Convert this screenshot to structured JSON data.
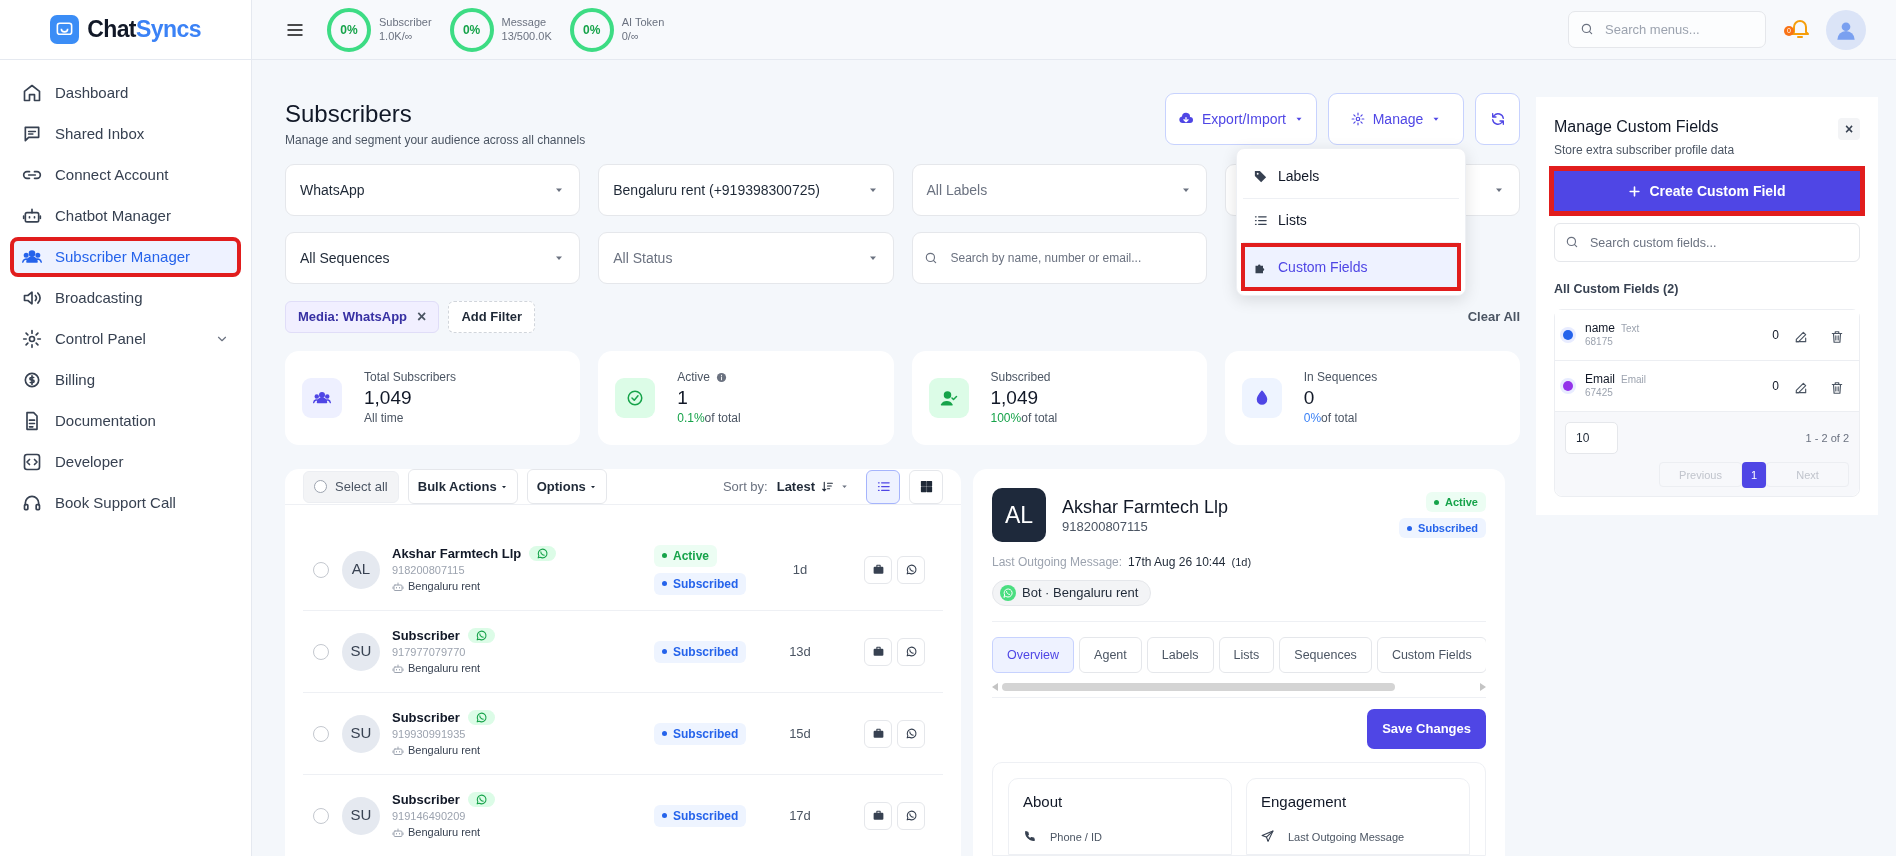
{
  "brand": {
    "name_dark": "Chat",
    "name_accent": "Syncs"
  },
  "usage": [
    {
      "percent": "0%",
      "label": "Subscriber",
      "value": "1.0K/∞"
    },
    {
      "percent": "0%",
      "label": "Message",
      "value": "13/500.0K"
    },
    {
      "percent": "0%",
      "label": "AI Token",
      "value": "0/∞"
    }
  ],
  "search_menus": {
    "placeholder": "Search menus..."
  },
  "notifications": {
    "count": "0"
  },
  "sidebar": {
    "items": [
      {
        "label": "Dashboard",
        "selected": false,
        "has_submenu": false
      },
      {
        "label": "Shared Inbox",
        "selected": false,
        "has_submenu": false
      },
      {
        "label": "Connect Account",
        "selected": false,
        "has_submenu": false
      },
      {
        "label": "Chatbot Manager",
        "selected": false,
        "has_submenu": false
      },
      {
        "label": "Subscriber Manager",
        "selected": true,
        "has_submenu": false,
        "highlighted": true
      },
      {
        "label": "Broadcasting",
        "selected": false,
        "has_submenu": false
      },
      {
        "label": "Control Panel",
        "selected": false,
        "has_submenu": true
      },
      {
        "label": "Billing",
        "selected": false,
        "has_submenu": false
      },
      {
        "label": "Documentation",
        "selected": false,
        "has_submenu": false
      },
      {
        "label": "Developer",
        "selected": false,
        "has_submenu": false
      },
      {
        "label": "Book Support Call",
        "selected": false,
        "has_submenu": false
      }
    ]
  },
  "page": {
    "title": "Subscribers",
    "subtitle": "Manage and segment your audience across all channels"
  },
  "actions": [
    {
      "kind": "export",
      "label": "Export/Import"
    },
    {
      "kind": "manage",
      "label": "Manage"
    },
    {
      "kind": "refresh"
    }
  ],
  "manage_menu": [
    {
      "label": "Labels",
      "selected": false,
      "highlighted": false
    },
    {
      "label": "Lists",
      "selected": false,
      "highlighted": false
    },
    {
      "label": "Custom Fields",
      "selected": true,
      "highlighted": true
    }
  ],
  "filters": [
    {
      "kind": "select",
      "value": "WhatsApp"
    },
    {
      "kind": "select",
      "value": "Bengaluru rent (+919398300725)"
    },
    {
      "kind": "select",
      "placeholder": "All Labels"
    },
    {
      "kind": "select"
    },
    {
      "kind": "select",
      "value": "All Sequences"
    },
    {
      "kind": "select",
      "placeholder": "All Status"
    },
    {
      "kind": "search",
      "placeholder": "Search by name, number or email..."
    }
  ],
  "active_filters": [
    {
      "label": "Media: WhatsApp",
      "remove": "×"
    }
  ],
  "add_filter": "Add Filter",
  "clear_all": "Clear All",
  "stats": [
    {
      "kind": "total",
      "label": "Total Subscribers",
      "value": "1,049",
      "note": "All time"
    },
    {
      "kind": "active",
      "label": "Active",
      "value": "1",
      "accent": "0.1%",
      "note": "of total",
      "info": true
    },
    {
      "kind": "subscribed",
      "label": "Subscribed",
      "value": "1,049",
      "accent": "100%",
      "note": "of total"
    },
    {
      "kind": "sequences",
      "label": "In Sequences",
      "value": "0",
      "accent": "0%",
      "note": "of total"
    }
  ],
  "list_toolbar": {
    "select_all": "Select all",
    "bulk_actions": "Bulk Actions",
    "options": "Options",
    "sort_label": "Sort by:",
    "sort_value": "Latest",
    "select_all_checked": false,
    "views": [
      {
        "kind": "list",
        "selected": true
      },
      {
        "kind": "grid",
        "selected": false
      }
    ]
  },
  "subscribers": [
    {
      "initials": "AL",
      "name": "Akshar Farmtech Llp",
      "phone": "918200807115",
      "bot": "Bengaluru rent",
      "checked": false,
      "active": true,
      "subscribed": true,
      "age": "1d",
      "active_label": "Active",
      "subscribed_label": "Subscribed"
    },
    {
      "initials": "SU",
      "name": "Subscriber",
      "phone": "917977079770",
      "bot": "Bengaluru rent",
      "checked": false,
      "active": false,
      "subscribed": true,
      "age": "13d",
      "subscribed_label": "Subscribed"
    },
    {
      "initials": "SU",
      "name": "Subscriber",
      "phone": "919930991935",
      "bot": "Bengaluru rent",
      "checked": false,
      "active": false,
      "subscribed": true,
      "age": "15d",
      "subscribed_label": "Subscribed"
    },
    {
      "initials": "SU",
      "name": "Subscriber",
      "phone": "919146490209",
      "bot": "Bengaluru rent",
      "checked": false,
      "active": false,
      "subscribed": true,
      "age": "17d",
      "subscribed_label": "Subscribed"
    }
  ],
  "detail": {
    "initials": "AL",
    "name": "Akshar Farmtech Llp",
    "phone": "918200807115",
    "badges": [
      {
        "kind": "active",
        "label": "Active"
      },
      {
        "kind": "subscribed",
        "label": "Subscribed"
      }
    ],
    "last_message_label": "Last Outgoing Message:",
    "last_message_value": "17th Aug 26 10:44",
    "last_message_age": "(1d)",
    "bot": "Bot · Bengaluru rent",
    "tabs": [
      {
        "label": "Overview",
        "selected": true
      },
      {
        "label": "Agent",
        "selected": false
      },
      {
        "label": "Labels",
        "selected": false
      },
      {
        "label": "Lists",
        "selected": false
      },
      {
        "label": "Sequences",
        "selected": false
      },
      {
        "label": "Custom Fields",
        "selected": false
      }
    ],
    "save": "Save Changes",
    "sections": [
      {
        "kind": "about",
        "title": "About",
        "row": "Phone / ID"
      },
      {
        "kind": "engagement",
        "title": "Engagement",
        "row": "Last Outgoing Message"
      }
    ]
  },
  "custom_fields_panel": {
    "title": "Manage Custom Fields",
    "subtitle": "Store extra subscriber profile data",
    "close": "×",
    "create": "Create Custom Field",
    "create_highlighted": true,
    "search_placeholder": "Search custom fields...",
    "list_title": "All Custom Fields (2)",
    "fields": [
      {
        "name": "name",
        "type": "Text",
        "id": "68175",
        "count": "0",
        "color": "#2563eb"
      },
      {
        "name": "Email",
        "type": "Email",
        "id": "67425",
        "count": "0",
        "color": "#9333ea"
      }
    ],
    "page_size": "10",
    "range": "1 - 2 of 2",
    "previous": "Previous",
    "pages": [
      {
        "label": "1",
        "selected": true
      }
    ],
    "next": "Next"
  }
}
